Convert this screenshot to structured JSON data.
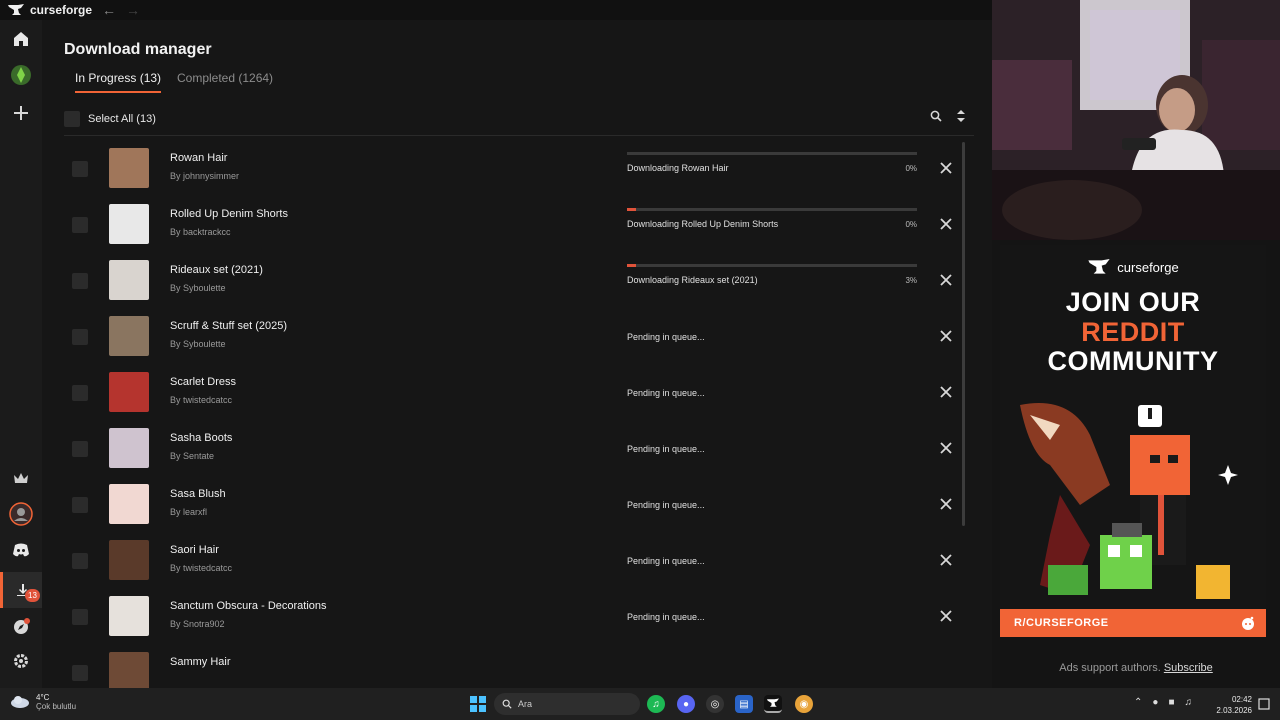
{
  "app": {
    "name": "curseforge",
    "accent": "#f16436"
  },
  "sidebar": {
    "items": [
      {
        "icon": "home-icon",
        "active": false
      },
      {
        "icon": "sims-plumbob-icon",
        "active": false
      },
      {
        "icon": "plus-icon",
        "active": false
      },
      {
        "icon": "crown-icon",
        "active": false
      },
      {
        "icon": "avatar-icon",
        "active": false
      },
      {
        "icon": "discord-icon",
        "active": false
      },
      {
        "icon": "download-icon",
        "active": true,
        "badge": "13"
      },
      {
        "icon": "compass-icon",
        "active": false
      },
      {
        "icon": "gear-icon",
        "active": false
      }
    ]
  },
  "page": {
    "title": "Download manager",
    "tabs": [
      {
        "label": "In Progress (13)",
        "active": true
      },
      {
        "label": "Completed (1264)",
        "active": false
      }
    ],
    "select_all": "Select All (13)"
  },
  "downloads": [
    {
      "name": "Rowan Hair",
      "author": "By johnnysimmer",
      "status": "Downloading Rowan Hair",
      "percent": "0%",
      "progress": 0,
      "thumb": "#a0765a"
    },
    {
      "name": "Rolled Up Denim Shorts",
      "author": "By backtrackcc",
      "status": "Downloading Rolled Up Denim Shorts",
      "percent": "0%",
      "progress": 0.03,
      "thumb": "#e8e8e8"
    },
    {
      "name": "Rideaux set (2021)",
      "author": "By Syboulette",
      "status": "Downloading Rideaux set (2021)",
      "percent": "3%",
      "progress": 0.03,
      "thumb": "#d9d4cf"
    },
    {
      "name": "Scruff & Stuff set (2025)",
      "author": "By Syboulette",
      "status": "Pending in queue...",
      "thumb": "#8a7560"
    },
    {
      "name": "Scarlet Dress",
      "author": "By twistedcatcc",
      "status": "Pending in queue...",
      "thumb": "#b5342e"
    },
    {
      "name": "Sasha Boots",
      "author": "By Sentate",
      "status": "Pending in queue...",
      "thumb": "#cfc3cf"
    },
    {
      "name": "Sasa Blush",
      "author": "By learxfl",
      "status": "Pending in queue...",
      "thumb": "#f1d8d2"
    },
    {
      "name": "Saori Hair",
      "author": "By twistedcatcc",
      "status": "Pending in queue...",
      "thumb": "#5a3a2a"
    },
    {
      "name": "Sanctum Obscura - Decorations",
      "author": "By Snotra902",
      "status": "Pending in queue...",
      "thumb": "#e6e1dc"
    },
    {
      "name": "Sammy Hair",
      "author": "",
      "status": "",
      "thumb": "#6e4a36"
    }
  ],
  "ad": {
    "logo": "curseforge",
    "line1": "JOIN OUR",
    "line2": "REDDIT",
    "line3": "COMMUNITY",
    "footer": "R/CURSEFORGE",
    "note": "Ads support authors.",
    "subscribe": "Subscribe"
  },
  "taskbar": {
    "temp": "4°C",
    "weather": "Çok bulutlu",
    "search_placeholder": "Ara",
    "time": "02:42",
    "date": "2.03.2026",
    "icons": [
      "windows-icon",
      "spotify-icon",
      "discord-icon",
      "chrome-canary-icon",
      "files-icon",
      "curseforge-icon",
      "chrome-icon"
    ]
  }
}
